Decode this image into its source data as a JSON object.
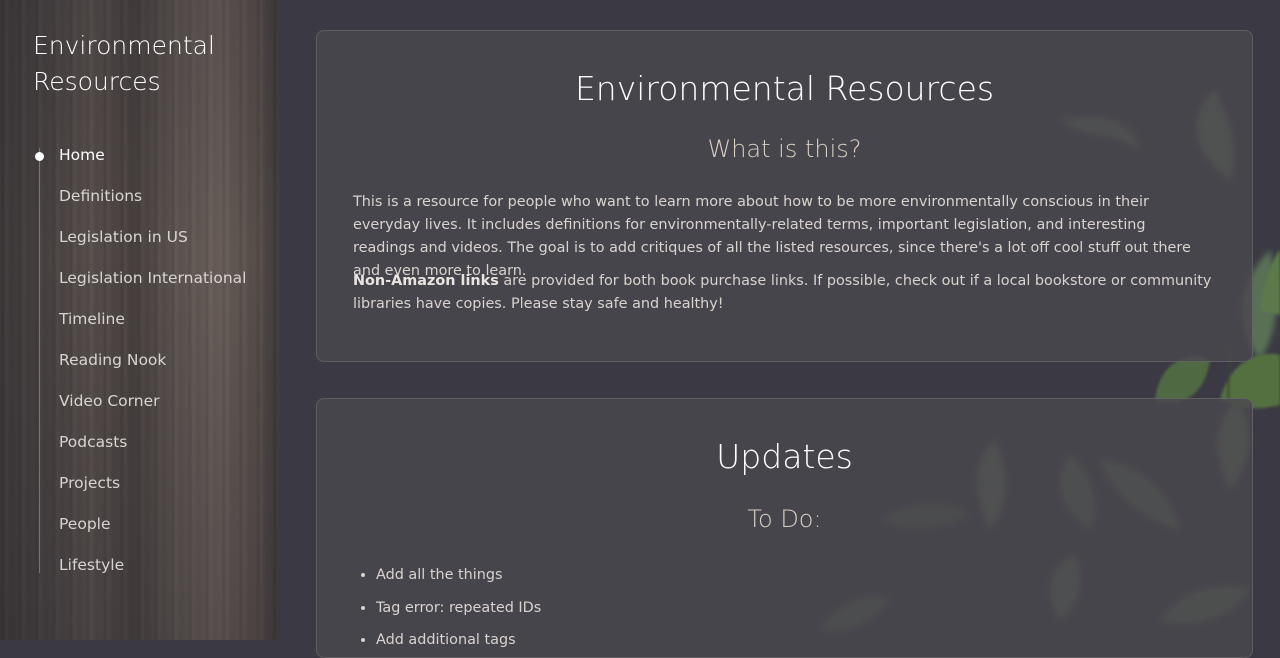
{
  "sidebar": {
    "site_title": "Environmental Resources",
    "nav": [
      {
        "label": "Home",
        "active": true
      },
      {
        "label": "Definitions"
      },
      {
        "label": "Legislation in US"
      },
      {
        "label": "Legislation International"
      },
      {
        "label": "Timeline"
      },
      {
        "label": "Reading Nook"
      },
      {
        "label": "Video Corner"
      },
      {
        "label": "Podcasts"
      },
      {
        "label": "Projects"
      },
      {
        "label": "People"
      },
      {
        "label": "Lifestyle"
      }
    ]
  },
  "intro": {
    "title": "Environmental Resources",
    "subtitle": "What is this?",
    "paragraph1": "This is a resource for people who want to learn more about how to be more environmentally conscious in their everyday lives. It includes definitions for environmentally-related terms, important legislation, and interesting readings and videos. The goal is to add critiques of all the listed resources, since there's a lot off cool stuff out there and even more to learn.",
    "paragraph2_bold": "Non-Amazon links",
    "paragraph2_rest": " are provided for both book purchase links. If possible, check out if a local bookstore or community libraries have copies. Please stay safe and healthy!"
  },
  "updates": {
    "title": "Updates",
    "subtitle": "To Do:",
    "items": [
      "Add all the things",
      "Tag error: repeated IDs",
      "Add additional tags"
    ]
  },
  "colors": {
    "page_bg": "#3b3a44",
    "card_bg": "#4a484e",
    "heading": "#ffffff",
    "subheading": "#d9cfc3",
    "body_text": "#d9d3cf"
  }
}
